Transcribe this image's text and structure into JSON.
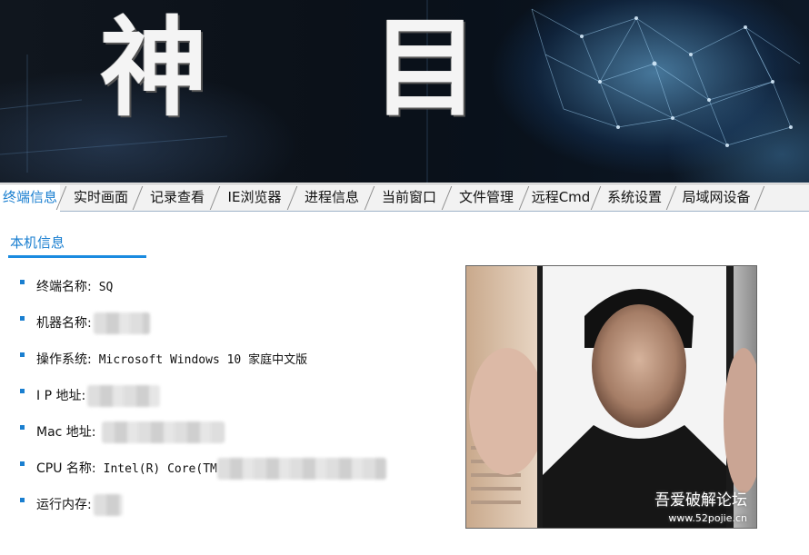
{
  "banner": {
    "title": "神 目"
  },
  "tabs": [
    {
      "label": "终端信息",
      "active": true
    },
    {
      "label": "实时画面"
    },
    {
      "label": "记录查看"
    },
    {
      "label": "IE浏览器"
    },
    {
      "label": "进程信息"
    },
    {
      "label": "当前窗口"
    },
    {
      "label": "文件管理"
    },
    {
      "label": "远程Cmd"
    },
    {
      "label": "系统设置"
    },
    {
      "label": "局域网设备"
    }
  ],
  "section": {
    "title": "本机信息"
  },
  "info": {
    "terminal_name": {
      "label": "终端名称:",
      "value": "SQ"
    },
    "machine_name": {
      "label": "机器名称:"
    },
    "os": {
      "label": "操作系统:",
      "value": "Microsoft Windows 10 家庭中文版"
    },
    "ip": {
      "label": "I P 地址:"
    },
    "mac": {
      "label": "Mac 地址:"
    },
    "cpu": {
      "label": "CPU 名称:",
      "value": "Intel(R) Core(TM"
    },
    "memory": {
      "label": "运行内存:"
    }
  },
  "watermark": {
    "text": "吾爱破解论坛",
    "url": "www.52pojie.cn"
  },
  "colors": {
    "accent": "#1a7fd0",
    "underline": "#1a8be0"
  }
}
